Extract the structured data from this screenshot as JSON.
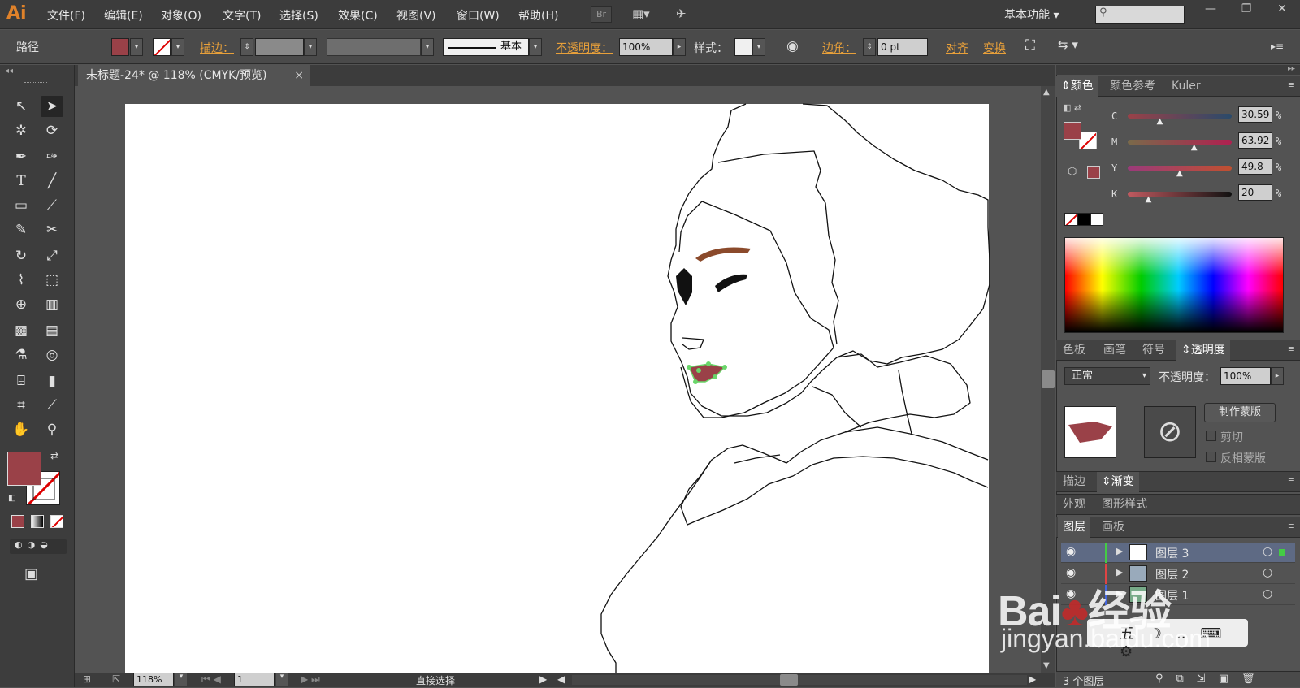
{
  "app": {
    "logo": "Ai"
  },
  "menu": [
    "文件(F)",
    "编辑(E)",
    "对象(O)",
    "文字(T)",
    "选择(S)",
    "效果(C)",
    "视图(V)",
    "窗口(W)",
    "帮助(H)"
  ],
  "bridge_label": "Br",
  "workspace": "基本功能",
  "window_buttons": [
    "—",
    "❐",
    "✕"
  ],
  "control_bar": {
    "object_type": "路径",
    "stroke_label": "描边：",
    "stroke_profile": "基本",
    "opacity_label": "不透明度：",
    "opacity_value": "100%",
    "style_label": "样式：",
    "corner_label": "边角：",
    "corner_value": "0 pt",
    "align_label": "对齐",
    "transform_label": "变换"
  },
  "document_tab": {
    "title": "未标题-24* @ 118% (CMYK/预览)",
    "close": "×"
  },
  "status_bar": {
    "zoom": "118%",
    "page": "1",
    "tool_name": "直接选择"
  },
  "colors": {
    "fill": "#9a4148",
    "accent": "#e8a03a",
    "eyebrow": "#8b4a2b",
    "selection": "#6ad66a"
  },
  "color_panel": {
    "tabs": [
      "颜色",
      "颜色参考",
      "Kuler"
    ],
    "channels": [
      {
        "label": "C",
        "value": "30.59",
        "level": 0.31
      },
      {
        "label": "M",
        "value": "63.92",
        "level": 0.64
      },
      {
        "label": "Y",
        "value": "49.8",
        "level": 0.5
      },
      {
        "label": "K",
        "value": "20",
        "level": 0.2
      }
    ],
    "percent": "%"
  },
  "transparency_panel": {
    "tabs": [
      "色板",
      "画笔",
      "符号",
      "透明度"
    ],
    "blend_mode": "正常",
    "opacity_label": "不透明度：",
    "opacity_value": "100%",
    "make_mask": "制作蒙版",
    "clip": "剪切",
    "invert_mask": "反相蒙版"
  },
  "stroke_panel": {
    "tabs": [
      "描边",
      "渐变"
    ]
  },
  "appearance_panel": {
    "tabs": [
      "外观",
      "图形样式"
    ]
  },
  "layers_panel": {
    "tabs": [
      "图层",
      "画板"
    ],
    "layers": [
      {
        "name": "图层 3",
        "selected": true
      },
      {
        "name": "图层 2",
        "selected": false
      },
      {
        "name": "图层 1",
        "selected": false
      }
    ],
    "count": "3 个图层"
  },
  "watermark": {
    "brand": "Bai",
    "brand2": "经验",
    "url": "jingyan.baidu.com"
  }
}
